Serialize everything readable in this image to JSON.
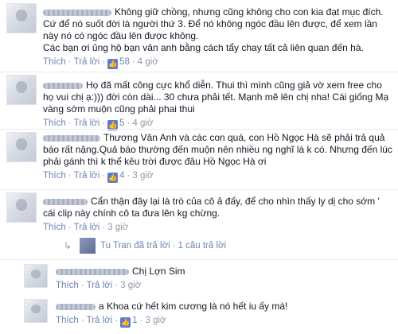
{
  "actions": {
    "like": "Thích",
    "reply": "Trả lời",
    "dot": "·"
  },
  "comments": [
    {
      "text": "Không giữ chồng, nhưng cũng không cho con kia đạt mục đích. Cứ để nó suốt đời là người thứ 3. Để nó không ngóc đầu lên được, để xem lần này nó có ngóc đầu lên được không.",
      "text2": "Các bạn ơi ủng hộ bạn vân anh bằng cách tẩy chay tất cả liên quan đến hà.",
      "likes": "58",
      "time": "4 giờ"
    },
    {
      "text": "Họ đã mất công cực khổ diễn. Thui thì mình cũng giả vờ xem free cho họ vui chị ạ:))) đời còn dài... 30 chưa phải tết. Mạnh mẽ lên chị nha! Cái giống Mạ vàng sớm muộn cũng phải phai thui",
      "likes": "5",
      "time": "4 giờ"
    },
    {
      "text": "Thương Vân Anh và các con quá, con Hồ Ngọc Hà sẽ phải trả quả báo rất nặng.Quả báo thường đến muộn nên nhiều ng nghĩ là k có. Nhưng đến lúc phải gánh thì k thể kêu trời được đâu Hồ Ngọc Hà ơi",
      "likes": "4",
      "time": "3 giờ"
    },
    {
      "text": "Cẩn thận đây lại là trò của cô ả đấy, để cho nhìn thấy ly dị cho sớm ' cái clip này chính cô ta đưa lên kg chừng.",
      "time": "3 giờ"
    },
    {
      "text": "Chị Lợn Sim",
      "time": "3 giờ"
    },
    {
      "text": "a Khoa cứ hết kim cương là nó hết iu ấy mà!",
      "likes": "1",
      "time": "3 giờ"
    }
  ],
  "reply_summary": {
    "name": "Tu Tran",
    "action": "đã trả lời",
    "count": "1 câu trả lời"
  }
}
